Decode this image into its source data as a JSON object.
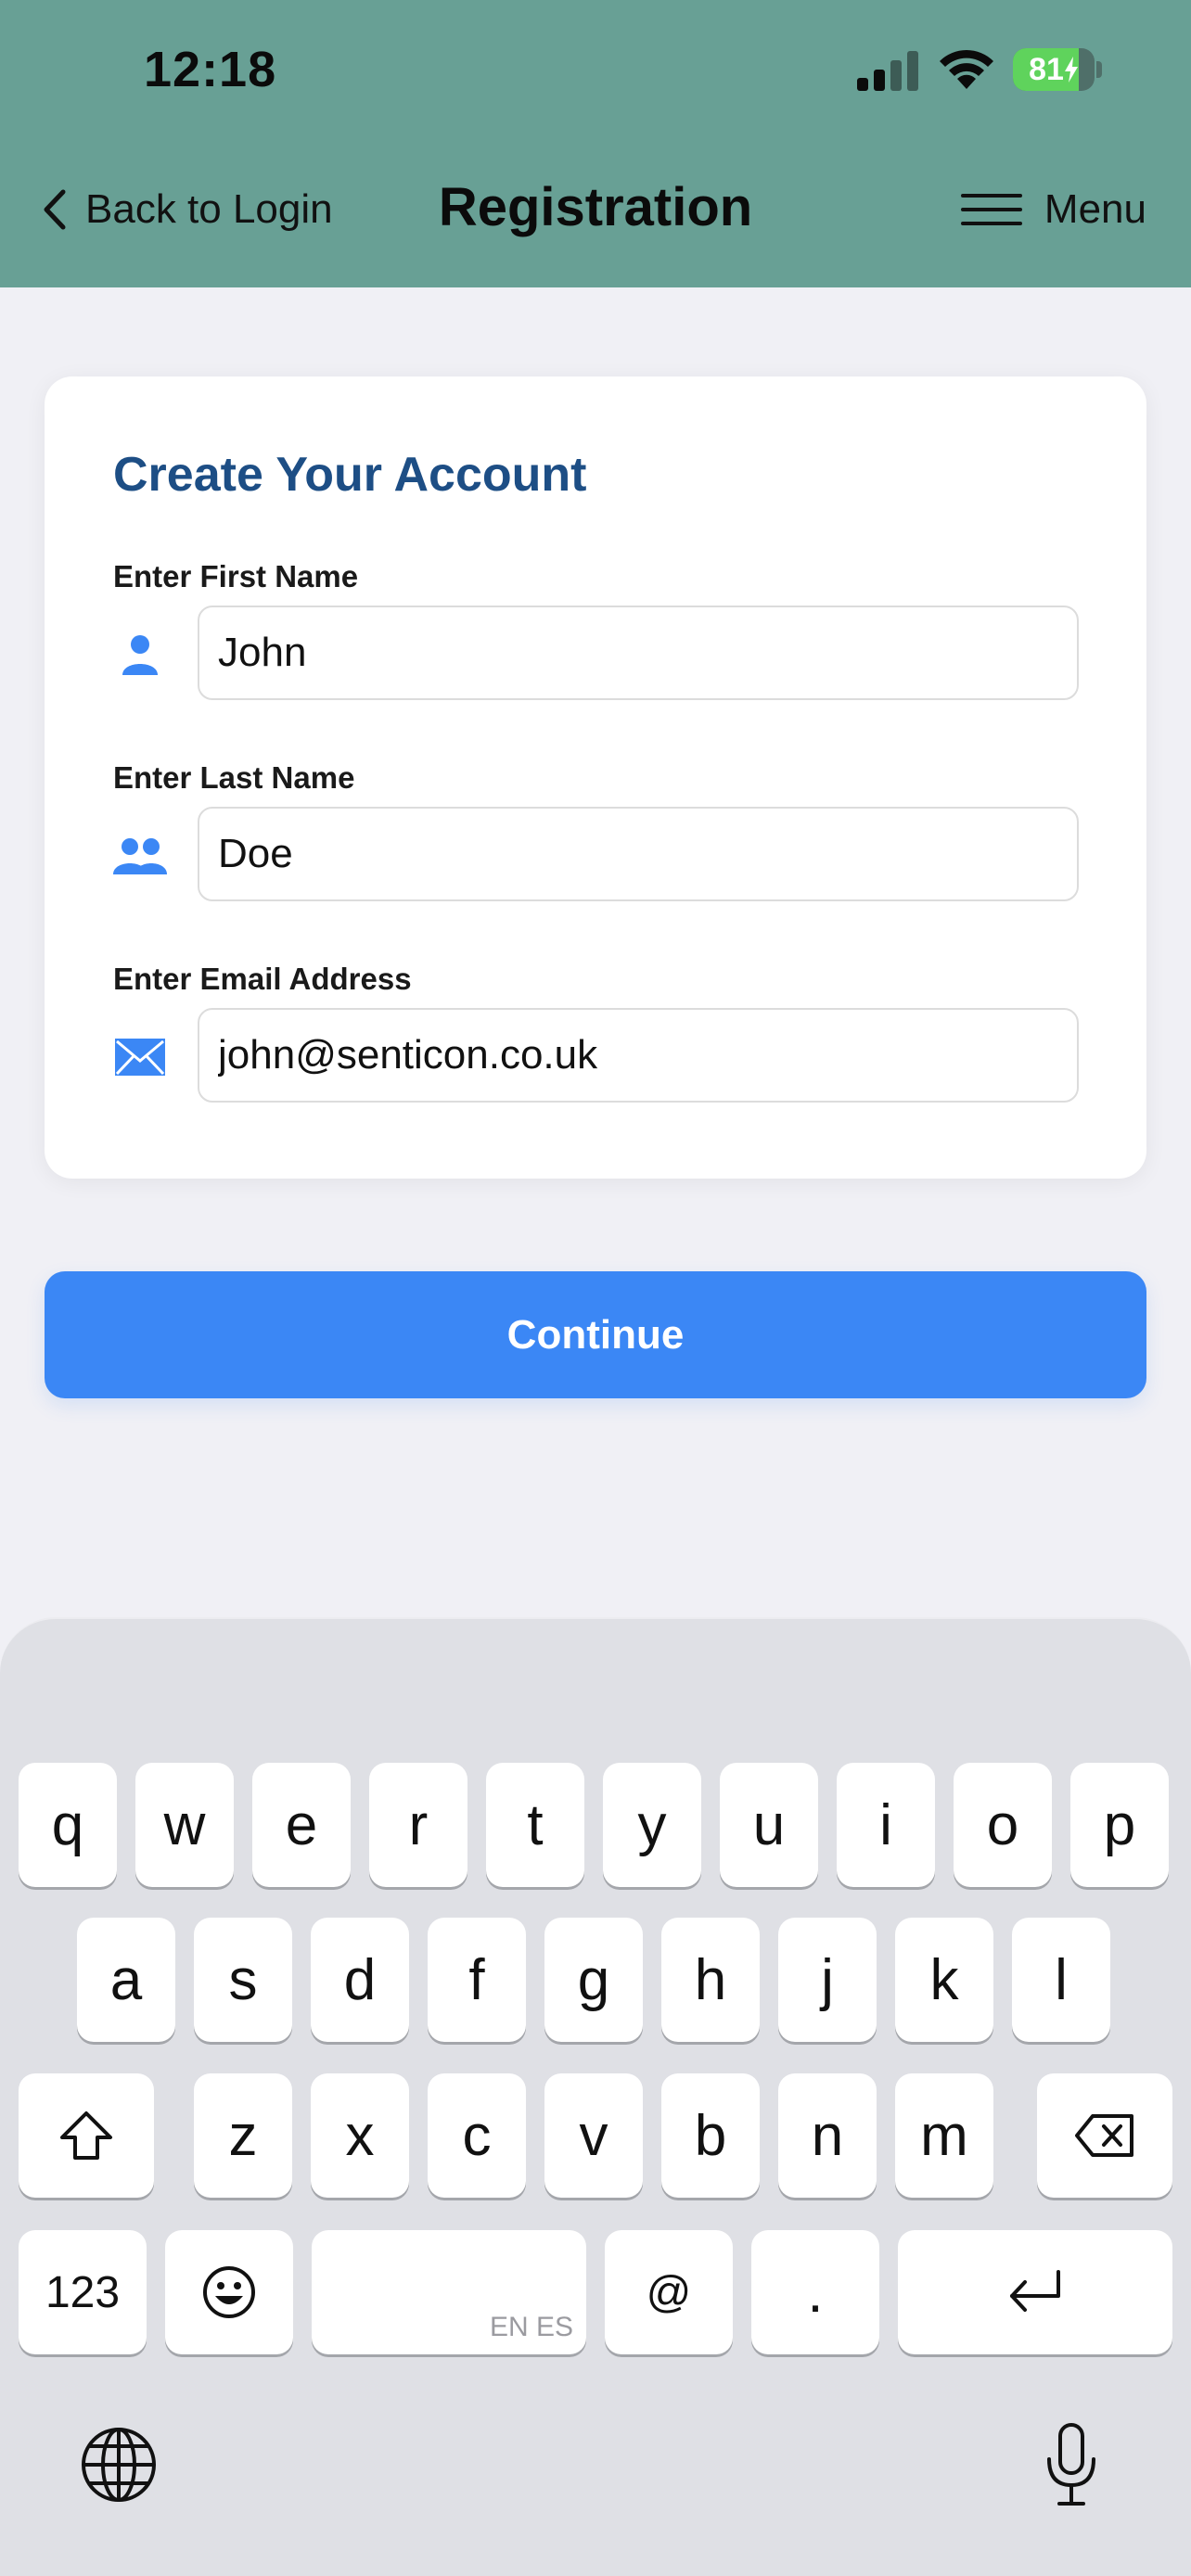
{
  "status_bar": {
    "time": "12:18",
    "battery_level": "81",
    "battery_fraction": 0.81,
    "icons": [
      "signal-icon",
      "wifi-icon",
      "battery-charging-icon"
    ]
  },
  "nav": {
    "back_label": "Back to Login",
    "title": "Registration",
    "menu_label": "Menu",
    "icons": [
      "chevron-left-icon",
      "hamburger-icon"
    ]
  },
  "form": {
    "title": "Create Your Account",
    "fields": [
      {
        "label": "Enter First Name",
        "value": "John",
        "icon": "person-icon"
      },
      {
        "label": "Enter Last Name",
        "value": "Doe",
        "icon": "people-icon"
      },
      {
        "label": "Enter Email Address",
        "value": "john@senticon.co.uk",
        "icon": "envelope-icon"
      }
    ]
  },
  "continue_label": "Continue",
  "keyboard": {
    "row1": [
      "q",
      "w",
      "e",
      "r",
      "t",
      "y",
      "u",
      "i",
      "o",
      "p"
    ],
    "row2": [
      "a",
      "s",
      "d",
      "f",
      "g",
      "h",
      "j",
      "k",
      "l"
    ],
    "row3": [
      "z",
      "x",
      "c",
      "v",
      "b",
      "n",
      "m"
    ],
    "numbers_label": "123",
    "space_hint": "EN ES",
    "at_label": "@",
    "period_label": ".",
    "icons": [
      "shift-icon",
      "delete-icon",
      "emoji-icon",
      "return-icon",
      "globe-icon",
      "microphone-icon"
    ]
  },
  "colors": {
    "header": "#68a095",
    "accent": "#3b87f5",
    "title": "#1d4e85",
    "icon": "#3b87f5"
  }
}
